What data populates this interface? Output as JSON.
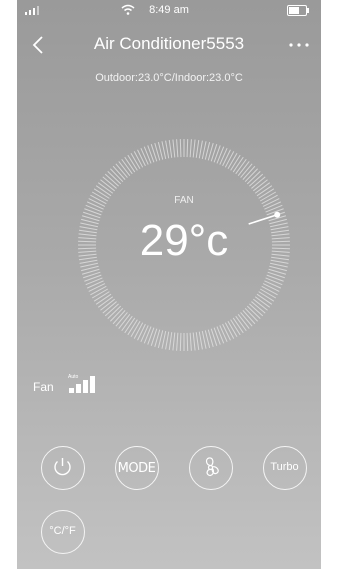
{
  "status": {
    "time": "8:49 am"
  },
  "header": {
    "title": "Air Conditioner5553",
    "outdoor_indoor": "Outdoor:23.0°C/Indoor:23.0°C"
  },
  "dial": {
    "mode": "FAN",
    "temperature": "29°c"
  },
  "fan": {
    "label": "Fan",
    "auto_label": "Auto",
    "level_bars": 4
  },
  "controls": {
    "mode_label": "MODE",
    "turbo_label": "Turbo",
    "unit_label": "°C/°F"
  },
  "colors": {
    "background_top": "#9a9a9a",
    "background_bottom": "#c2c2c2",
    "foreground": "#ffffff"
  }
}
